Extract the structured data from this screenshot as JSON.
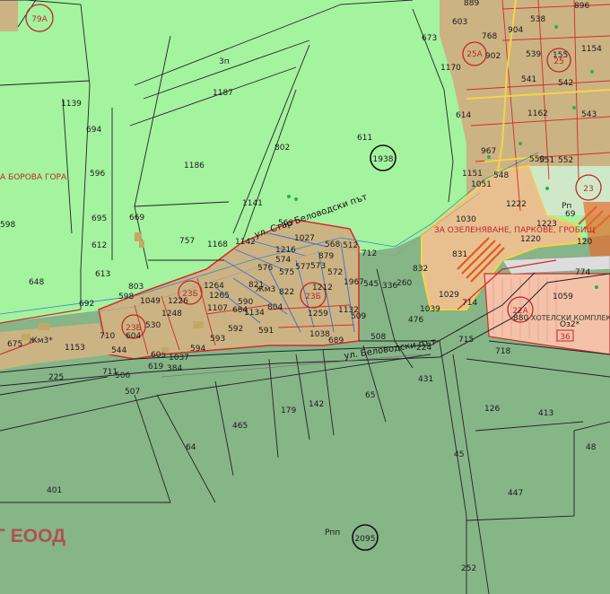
{
  "colors": {
    "lightgreen": "#a4f39f",
    "darkgreen": "#86b588",
    "tan": "#ccb383",
    "orange_dev": "#e8c090",
    "red_line": "#d22b2b",
    "black_line": "#222222",
    "blue_line": "#3a88c6",
    "yellow_line": "#f2d548"
  },
  "zones": {
    "z79a": "79А",
    "z25a": "25А",
    "z25": "25",
    "z23": "23",
    "z23b_1": "23Б",
    "z23b_2": "23Б",
    "z23b_3": "23Б",
    "z22a": "22А",
    "z36": "36"
  },
  "circles": {
    "c1938": "1938",
    "c2095": "2095"
  },
  "streets": {
    "upper": "ул. Стар Беловодски път",
    "lower": "ул. Беловодски път"
  },
  "labels": {
    "l3p": "3п",
    "rpp": "Рпп",
    "zhm3a": "Жм3*",
    "zhm3b": "Жм3",
    "oz2": "Оз2*",
    "rp": "Рп",
    "company": "Г ЕООД",
    "borova": "А БОРОВА ГОРА",
    "ozelenyavane": "ЗА ОЗЕЛЕНЯВАНЕ, ПАРКОВЕ, ГРОБИЩ",
    "hotel": "ХОТЕЛСКИ КОМПЛЕКС"
  },
  "parcels": {
    "p1187": "1187",
    "p802": "802",
    "p611": "611",
    "p673": "673",
    "p1170": "1170",
    "p614": "614",
    "p1139": "1139",
    "p694": "694",
    "p596": "596",
    "p1186": "1186",
    "p695": "695",
    "p669": "669",
    "p612": "612",
    "p613": "613",
    "p757": "757",
    "p1141": "1141",
    "p648": "648",
    "p598": "598",
    "p692": "692",
    "p803": "803",
    "p1168": "1168",
    "p1142": "1142",
    "p563": "563",
    "p1027": "1027",
    "p568": "568",
    "p512": "512",
    "p712": "712",
    "p832": "832",
    "p1030": "1030",
    "p831": "831",
    "p1151": "1151",
    "p1051": "1051",
    "p1222": "1222",
    "p1223": "1223",
    "p1220": "1220",
    "p774": "774",
    "p1059": "1059",
    "p1029": "1029",
    "p714": "714",
    "p1039": "1039",
    "p476": "476",
    "p715": "715",
    "p718": "718",
    "p260": "260",
    "p336": "336",
    "p545": "545",
    "p1967": "1967",
    "p508": "508",
    "p224": "224",
    "p431": "431",
    "p65": "65",
    "p126": "126",
    "p413": "413",
    "p48": "48",
    "p447": "447",
    "p45": "45",
    "p252": "252",
    "p142": "142",
    "p179": "179",
    "p465": "465",
    "p64": "64",
    "p401": "401",
    "p507": "507",
    "p225": "225",
    "p711": "711",
    "p506": "506",
    "p675": "675",
    "p1153": "1153",
    "p544": "544",
    "p710": "710",
    "p604": "604",
    "p530": "530",
    "p605": "605",
    "p619": "619",
    "p384": "384",
    "p1037": "1037",
    "p594": "594",
    "p593": "593",
    "p1248": "1248",
    "p1049": "1049",
    "p1264": "1264",
    "p1265": "1265",
    "p1107": "1107",
    "p684": "684",
    "p592": "592",
    "p590": "590",
    "p821": "821",
    "p1134": "1134",
    "p591": "591",
    "p804": "804",
    "p822": "822",
    "p1259": "1259",
    "p1212": "1212",
    "p1038": "1038",
    "p689": "689",
    "p576": "576",
    "p574": "574",
    "p575": "575",
    "p577": "577",
    "p1216": "1216",
    "p573": "573",
    "p572": "572",
    "p879": "879",
    "p1132": "1132",
    "p509": "509",
    "p1226": "1226",
    "p603": "603",
    "p889": "889",
    "p538": "538",
    "p904": "904",
    "p768": "768",
    "p902": "902",
    "p539": "539",
    "p541": "541",
    "p542": "542",
    "p543": "543",
    "p1154": "1154",
    "p1162": "1162",
    "p548": "548",
    "p551": "551",
    "p552": "552",
    "p550": "550",
    "p967": "967",
    "p880": "880",
    "p69": "69",
    "p120": "120",
    "p896": "896",
    "p1155": "155"
  }
}
